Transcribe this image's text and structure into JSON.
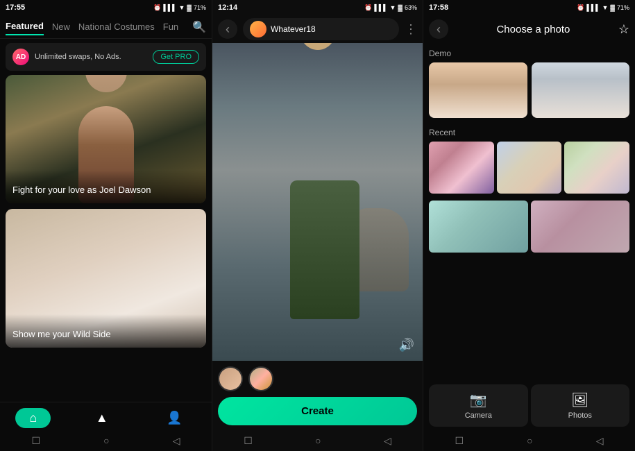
{
  "panel1": {
    "status_time": "17:55",
    "status_battery": "71%",
    "tabs": [
      {
        "label": "Featured",
        "active": true
      },
      {
        "label": "New",
        "active": false
      },
      {
        "label": "National Costumes",
        "active": false
      },
      {
        "label": "Fun",
        "active": false
      }
    ],
    "promo": {
      "text": "Unlimited swaps, No Ads.",
      "button": "Get PRO"
    },
    "cards": [
      {
        "label": "Fight for your love as Joel Dawson"
      },
      {
        "label": "Show me your Wild Side"
      }
    ],
    "nav_items": [
      {
        "icon": "🏠",
        "label": "",
        "active": true
      },
      {
        "icon": "⬆",
        "label": "",
        "active": false
      },
      {
        "icon": "👤",
        "label": "",
        "active": false
      }
    ]
  },
  "panel2": {
    "status_time": "12:14",
    "status_battery": "63%",
    "user_name": "Whatever18",
    "create_button": "Create"
  },
  "panel3": {
    "status_time": "17:58",
    "status_battery": "71%",
    "title": "Choose a photo",
    "sections": {
      "demo": "Demo",
      "recent": "Recent"
    },
    "camera_button": "Camera",
    "photos_button": "Photos"
  },
  "icons": {
    "back": "‹",
    "search": "🔍",
    "more": "⋮",
    "favorite": "☆",
    "sound": "🔊",
    "camera": "📷",
    "photos": "🖼",
    "home": "⌂",
    "upload": "▲",
    "profile": "👤",
    "square": "☐",
    "circle": "○",
    "triangle": "◁",
    "alarm": "⏰",
    "wifi": "📶",
    "battery": "🔋"
  }
}
